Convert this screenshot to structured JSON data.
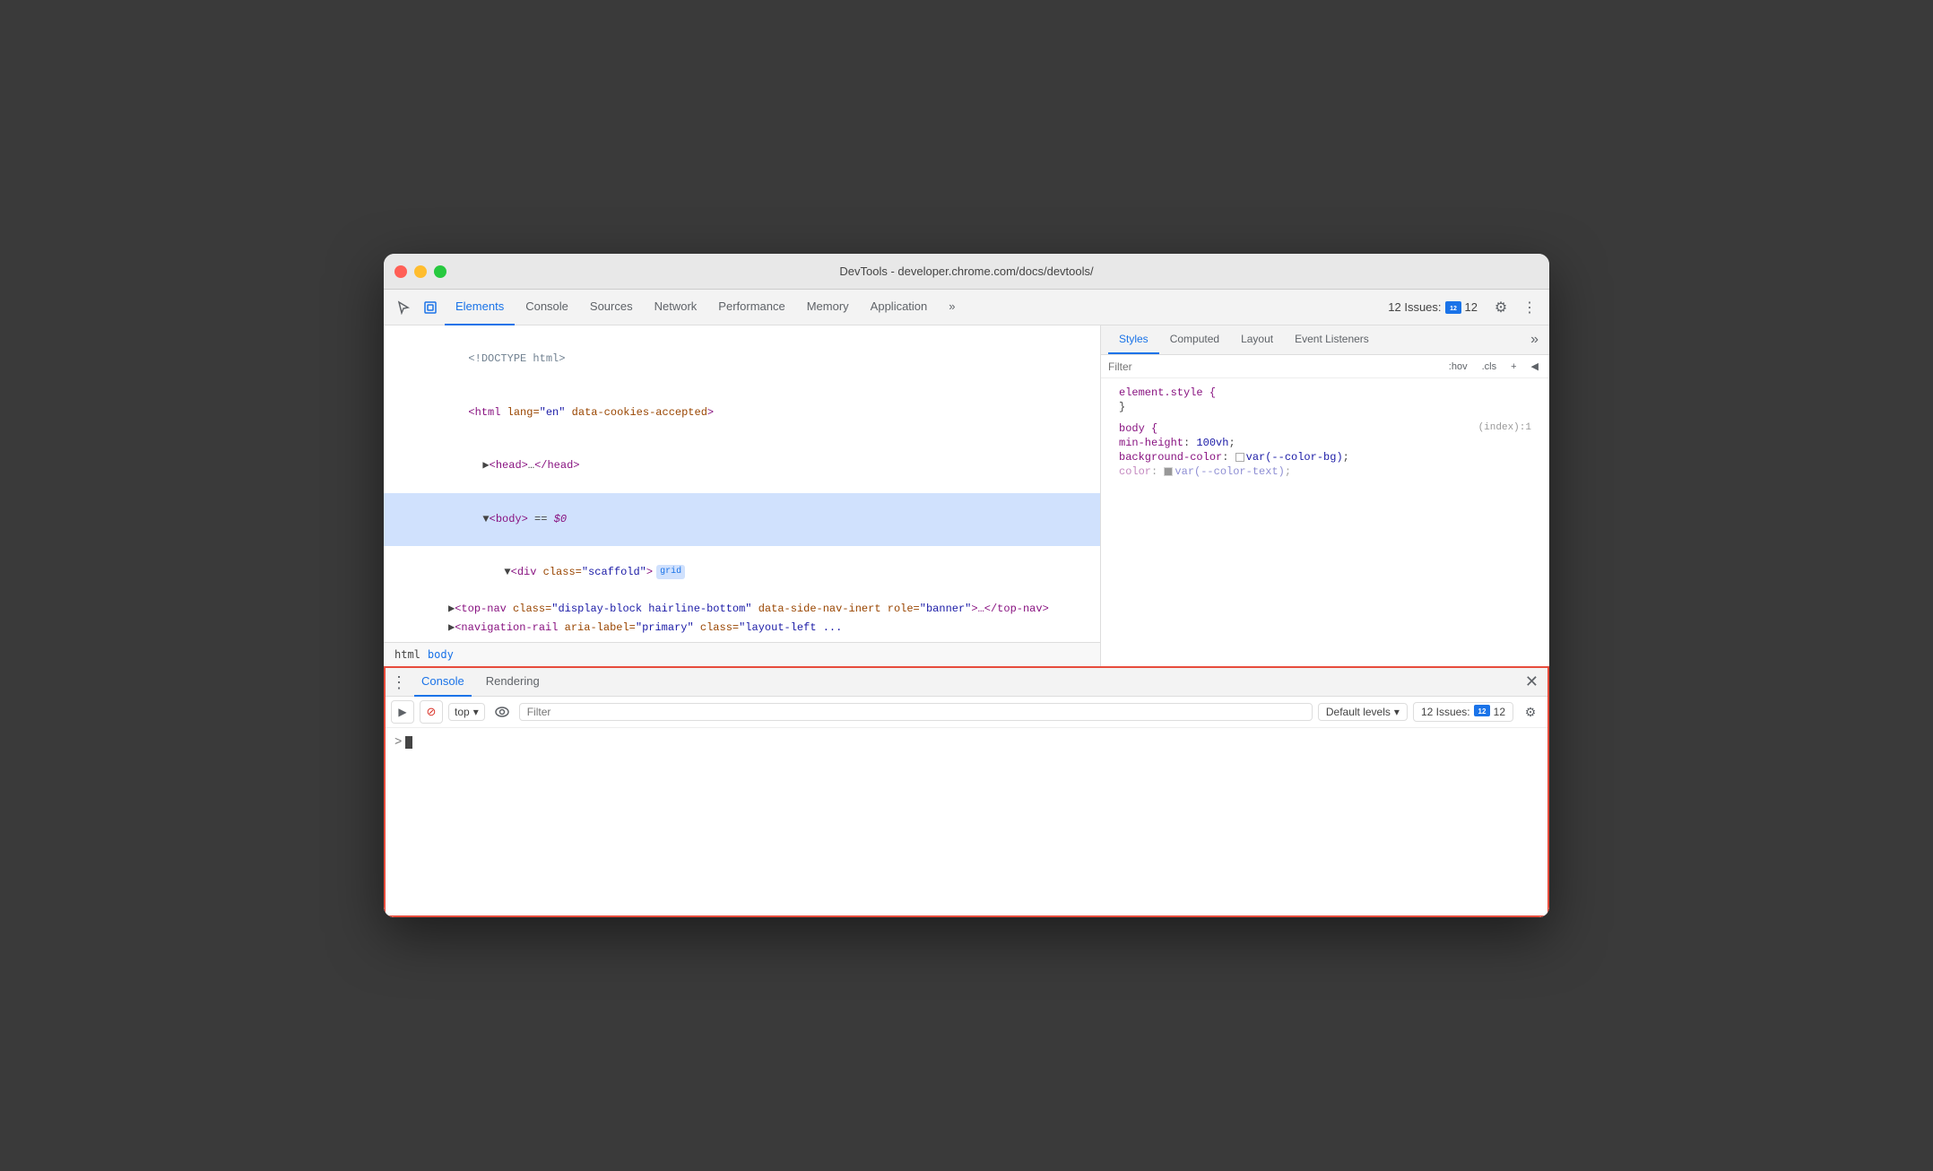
{
  "window": {
    "title": "DevTools - developer.chrome.com/docs/devtools/"
  },
  "toolbar": {
    "tabs": [
      {
        "label": "Elements",
        "active": true
      },
      {
        "label": "Console",
        "active": false
      },
      {
        "label": "Sources",
        "active": false
      },
      {
        "label": "Network",
        "active": false
      },
      {
        "label": "Performance",
        "active": false
      },
      {
        "label": "Memory",
        "active": false
      },
      {
        "label": "Application",
        "active": false
      }
    ],
    "more_label": "»",
    "issues_count": "12",
    "issues_label": "12 Issues:",
    "settings_icon": "⚙",
    "more_dots_icon": "⋮"
  },
  "elements": {
    "dom": [
      {
        "text": "<!DOCTYPE html>",
        "indent": 0,
        "type": "comment"
      },
      {
        "text": "<html lang=\"en\" data-cookies-accepted>",
        "indent": 0,
        "type": "tag"
      },
      {
        "text": "▶<head>…</head>",
        "indent": 1,
        "type": "tag"
      },
      {
        "text": "▼<body> == $0",
        "indent": 1,
        "type": "tag_selected"
      },
      {
        "text": "▼<div class=\"scaffold\">  grid",
        "indent": 2,
        "type": "tag"
      },
      {
        "text": "▶<top-nav class=\"display-block hairline-bottom\" data-side-nav-inert role=\"banner\">…</top-nav>",
        "indent": 3,
        "type": "tag"
      },
      {
        "text": "▶<navigation-rail aria-label=\"primary\" class=\"layout-left ...",
        "indent": 3,
        "type": "tag_truncated"
      }
    ],
    "breadcrumbs": [
      "html",
      "body"
    ]
  },
  "styles": {
    "tabs": [
      {
        "label": "Styles",
        "active": true
      },
      {
        "label": "Computed",
        "active": false
      },
      {
        "label": "Layout",
        "active": false
      },
      {
        "label": "Event Listeners",
        "active": false
      }
    ],
    "filter_placeholder": "Filter",
    "filter_buttons": [
      ":hov",
      ".cls",
      "+",
      "◀"
    ],
    "rules": [
      {
        "selector": "element.style {",
        "origin": "",
        "properties": [
          {
            "name": "",
            "value": "",
            "empty": true
          }
        ],
        "close": "}"
      },
      {
        "selector": "body {",
        "origin": "(index):1",
        "properties": [
          {
            "name": "min-height",
            "value": "100vh;"
          },
          {
            "name": "background-color",
            "value": "var(--color-bg);",
            "has_swatch": true
          },
          {
            "name": "color",
            "value": "var(--color-text);",
            "has_swatch": true,
            "truncated": true
          }
        ],
        "close": ""
      }
    ]
  },
  "console_drawer": {
    "tabs": [
      {
        "label": "Console",
        "active": true
      },
      {
        "label": "Rendering",
        "active": false
      }
    ],
    "toolbar": {
      "execute_icon": "▶",
      "block_icon": "🚫",
      "context_label": "top",
      "eye_icon": "👁",
      "filter_placeholder": "Filter",
      "levels_label": "Default levels",
      "issues_label": "12 Issues:",
      "issues_count": "12",
      "gear_icon": "⚙"
    },
    "prompt_arrow": ">",
    "close_icon": "✕"
  },
  "colors": {
    "accent_blue": "#1a73e8",
    "red_border": "#e74c3c",
    "tag_color": "#881280",
    "attr_name": "#994500",
    "attr_value": "#1a1aa6"
  }
}
